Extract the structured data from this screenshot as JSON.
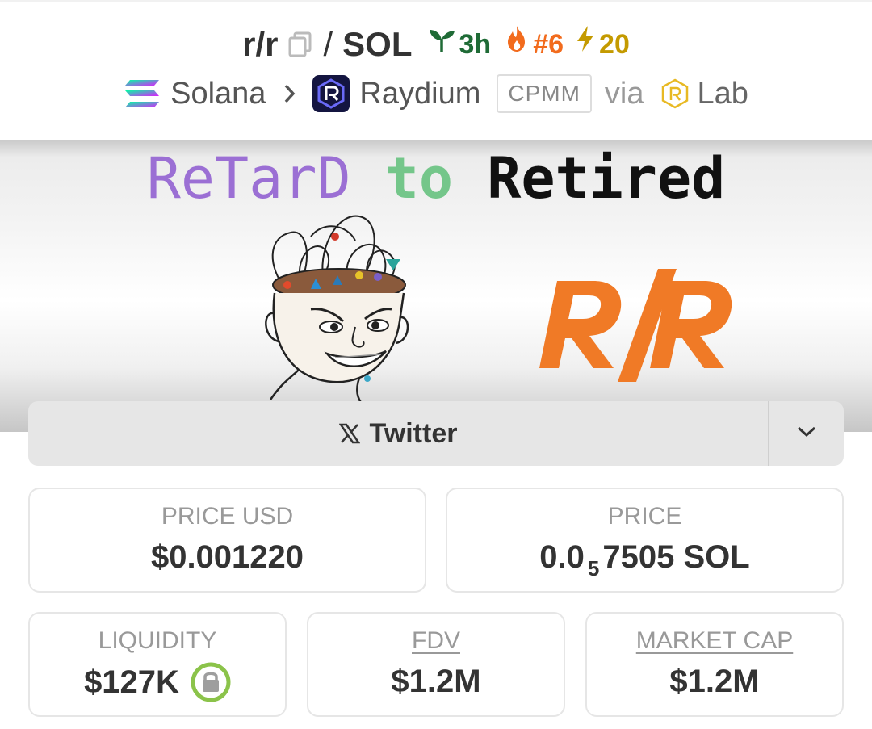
{
  "header": {
    "base_symbol": "r/r",
    "slash": "/",
    "quote_symbol": "SOL",
    "age": "3h",
    "rank": "#6",
    "boosts": "20",
    "chain": "Solana",
    "dex": "Raydium",
    "pool_type": "CPMM",
    "via": "via",
    "launchpad": "Lab"
  },
  "banner": {
    "headline_part1": "ReTarD",
    "headline_part2": "to",
    "headline_part3": "Retired",
    "logo_text": "R/R"
  },
  "social": {
    "label": "Twitter"
  },
  "stats": {
    "price_usd_label": "PRICE USD",
    "price_usd_value": "$0.001220",
    "price_label": "PRICE",
    "price_prefix": "0.0",
    "price_zero_count": "5",
    "price_suffix": "7505 SOL",
    "liquidity_label": "LIQUIDITY",
    "liquidity_value": "$127K",
    "fdv_label": "FDV",
    "fdv_value": "$1.2M",
    "mcap_label": "MARKET CAP",
    "mcap_value": "$1.2M"
  },
  "colors": {
    "age_green": "#1f6b36",
    "rank_orange": "#f26b1d",
    "boost_gold": "#c49a00",
    "headline_purple": "#9b6fd4",
    "headline_green": "#74c68a",
    "logo_orange": "#f07a26",
    "lock_green": "#8bc34a"
  },
  "icons": [
    "copy-icon",
    "seedling-icon",
    "flame-icon",
    "lightning-icon",
    "solana-icon",
    "chevron-right-icon",
    "raydium-icon",
    "lab-icon",
    "x-logo-icon",
    "chevron-down-icon",
    "lock-icon"
  ]
}
